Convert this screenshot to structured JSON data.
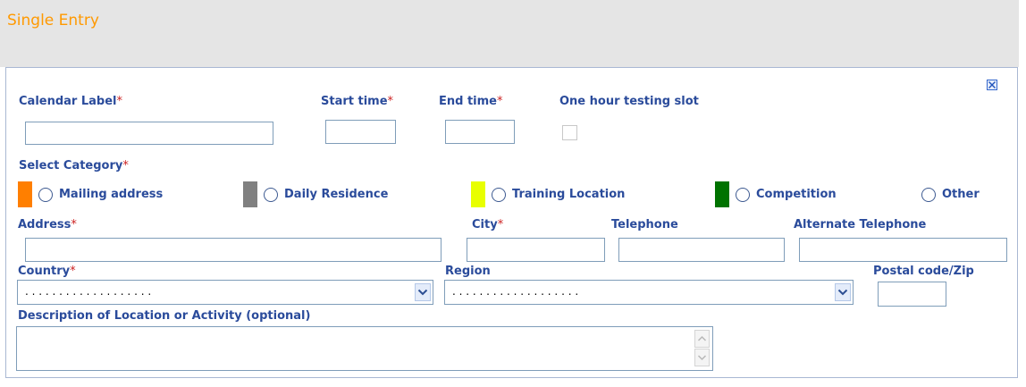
{
  "page": {
    "title": "Single Entry"
  },
  "form": {
    "required_marker": "*",
    "calendar_label": {
      "label": "Calendar Label",
      "value": ""
    },
    "start_time": {
      "label": "Start time",
      "value": ""
    },
    "end_time": {
      "label": "End time",
      "value": ""
    },
    "testing_slot": {
      "label": "One hour testing slot",
      "checked": false
    },
    "category": {
      "label": "Select Category",
      "options": [
        {
          "label": "Mailing address",
          "color": "#ff7f00"
        },
        {
          "label": "Daily Residence",
          "color": "#808080"
        },
        {
          "label": "Training Location",
          "color": "#e8ff00"
        },
        {
          "label": "Competition",
          "color": "#007300"
        },
        {
          "label": "Other",
          "color": "#ffffff"
        }
      ]
    },
    "address": {
      "label": "Address",
      "value": ""
    },
    "city": {
      "label": "City",
      "value": ""
    },
    "telephone": {
      "label": "Telephone",
      "value": ""
    },
    "alternate_telephone": {
      "label": "Alternate Telephone",
      "value": ""
    },
    "country": {
      "label": "Country",
      "selected": ". . . . . . . . . . . . . . . . . . ."
    },
    "region": {
      "label": "Region",
      "selected": ". . . . . . . . . . . . . . . . . . ."
    },
    "postal_code": {
      "label": "Postal code/Zip",
      "value": ""
    },
    "description": {
      "label": "Description of Location or Activity (optional)",
      "value": ""
    }
  },
  "icons": {
    "close": "close-icon",
    "dropdown": "chevron-down-icon",
    "scroll_up": "arrow-up-icon",
    "scroll_down": "arrow-down-icon"
  }
}
